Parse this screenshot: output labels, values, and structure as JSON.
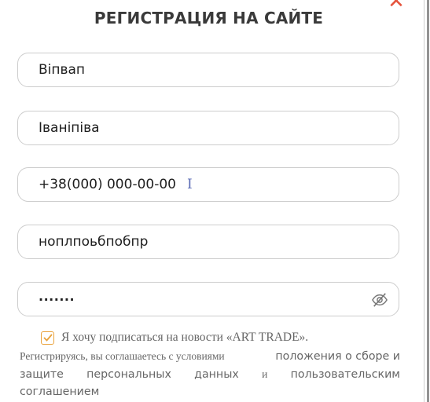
{
  "modal": {
    "title": "РЕГИСТРАЦИЯ НА САЙТЕ",
    "close_glyph": "✕"
  },
  "form": {
    "first_name": "Віпвап",
    "last_name": "Іваніпіва",
    "phone": "+38(000) 000-00-00",
    "caret_glyph": "I",
    "email": "ноплпоьбпобпр",
    "password": "·······"
  },
  "consent": {
    "checked": true,
    "label": "Я хочу подписаться на новости «ART TRADE»."
  },
  "legal": {
    "part1": "Регистрируясь, вы соглашаетесь с условиями",
    "link1": "положения о сборе и",
    "line2_a": "защите",
    "line2_b": "персональных",
    "line2_c": "данных",
    "line2_d": "и",
    "line2_e": "пользовательским",
    "line3": "соглашением"
  },
  "colors": {
    "accent": "#e9a23b",
    "close": "#e5533c"
  }
}
